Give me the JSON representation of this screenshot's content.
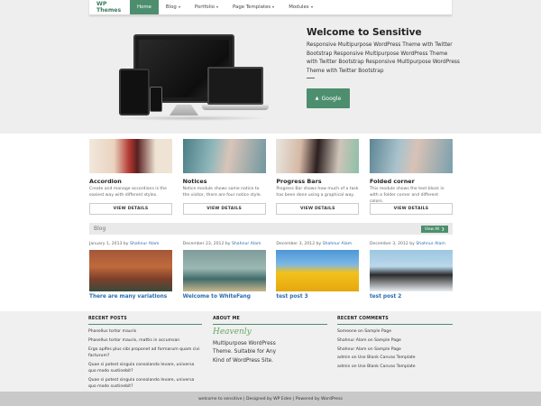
{
  "nav": {
    "brand": "WP Themes",
    "items": [
      {
        "label": "Home",
        "active": true,
        "dropdown": false
      },
      {
        "label": "Blog",
        "active": false,
        "dropdown": true
      },
      {
        "label": "Portfolio",
        "active": false,
        "dropdown": true
      },
      {
        "label": "Page Templates",
        "active": false,
        "dropdown": true
      },
      {
        "label": "Modules",
        "active": false,
        "dropdown": true
      }
    ]
  },
  "hero": {
    "title": "Welcome to Sensitive",
    "text": "Responsive Multipurpose WordPress Theme with Twitter Bootstrap Responsive Multipurpose WordPress Theme with Twitter Bootstrap Responsive Multipurpose WordPress Theme with Twitter Bootstrap",
    "button_label": "Google"
  },
  "features": [
    {
      "title": "Accordion",
      "desc": "Create and manage accordions is the easiest way with different styles.",
      "button": "VIEW DETAILS"
    },
    {
      "title": "Notices",
      "desc": "Notice module shows some notice to the visitor, there are four notice style.",
      "button": "VIEW DETAILS"
    },
    {
      "title": "Progress Bars",
      "desc": "Progress Bar shows how much of a task has been done using a graphical way.",
      "button": "VIEW DETAILS"
    },
    {
      "title": "Folded corner",
      "desc": "This module shows the text block in with a folder corner and different colors.",
      "button": "VIEW DETAILS"
    }
  ],
  "blog": {
    "section_title": "Blog",
    "view_all": "View All",
    "posts": [
      {
        "date": "January 1, 2013",
        "by": "by",
        "author": "Shahnur Alam",
        "title": "There are many variations"
      },
      {
        "date": "December 23, 2012",
        "by": "by",
        "author": "Shahnur Alam",
        "title": "Welcome to WhiteFang"
      },
      {
        "date": "December 3, 2012",
        "by": "by",
        "author": "Shahnur Alam",
        "title": "test post 3"
      },
      {
        "date": "December 3, 2012",
        "by": "by",
        "author": "Shahnur Alam",
        "title": "test post 2"
      }
    ]
  },
  "footer": {
    "recent_posts": {
      "heading": "RECENT POSTS",
      "items": [
        "Phasellus tortor mauris",
        "Phasellus tortor mauris, mattis in accumsan",
        "Ergo aplfes plus sibi proponet ad formarum quam civi facturum?",
        "Quae si potest singula consolando levare, universa quo modo sustinebit?",
        "Quae si potest singula consolando levare, universa quo modo sustinebit?"
      ]
    },
    "about": {
      "heading": "ABOUT ME",
      "logo_text": "Heavenly",
      "text": "Multipurpose WordPress Theme. Suitable for Any Kind of WordPress Site."
    },
    "recent_comments": {
      "heading": "RECENT COMMENTS",
      "items": [
        "Someone on Sample Page",
        "Shahnur Alam on Sample Page",
        "Shahnur Alam on Sample Page",
        "admin on Use Blank Canvas Template",
        "admin on Use Blank Canvas Template"
      ]
    },
    "copyright": "welcome to sensitive | Designed by WP Eden | Powered by WordPress"
  },
  "colors": {
    "accent": "#4d8e6e",
    "link": "#2b6cb0",
    "hero_bg": "#eeeeee",
    "footer_bg": "#f0f0f0",
    "copyright_bg": "#c9c9c9"
  }
}
